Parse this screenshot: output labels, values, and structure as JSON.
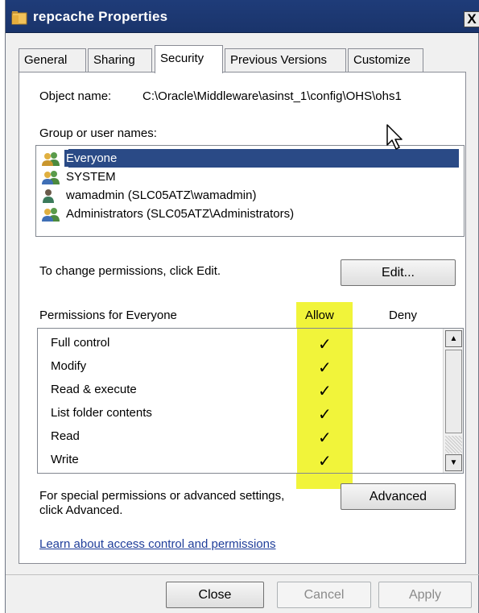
{
  "window": {
    "title": "repcache Properties",
    "close_glyph": "X"
  },
  "tabs": [
    {
      "label": "General",
      "active": false
    },
    {
      "label": "Sharing",
      "active": false
    },
    {
      "label": "Security",
      "active": true
    },
    {
      "label": "Previous Versions",
      "active": false
    },
    {
      "label": "Customize",
      "active": false
    }
  ],
  "security": {
    "object_name_label": "Object name:",
    "object_name_value": "C:\\Oracle\\Middleware\\asinst_1\\config\\OHS\\ohs1",
    "group_label": "Group or user names:",
    "users": [
      {
        "name": "Everyone",
        "icon": "group-icon",
        "selected": true
      },
      {
        "name": "SYSTEM",
        "icon": "group-icon",
        "selected": false
      },
      {
        "name": "wamadmin (SLC05ATZ\\wamadmin)",
        "icon": "user-icon",
        "selected": false
      },
      {
        "name": "Administrators (SLC05ATZ\\Administrators)",
        "icon": "group-icon",
        "selected": false
      }
    ],
    "change_text": "To change permissions, click Edit.",
    "edit_button": "Edit...",
    "permissions_label": "Permissions for Everyone",
    "allow_header": "Allow",
    "deny_header": "Deny",
    "permissions": [
      {
        "name": "Full control",
        "allow": true,
        "deny": false
      },
      {
        "name": "Modify",
        "allow": true,
        "deny": false
      },
      {
        "name": "Read & execute",
        "allow": true,
        "deny": false
      },
      {
        "name": "List folder contents",
        "allow": true,
        "deny": false
      },
      {
        "name": "Read",
        "allow": true,
        "deny": false
      },
      {
        "name": "Write",
        "allow": true,
        "deny": false
      }
    ],
    "check_glyph": "✓",
    "special_text_line1": "For special permissions or advanced settings,",
    "special_text_line2": "click Advanced.",
    "advanced_button": "Advanced",
    "learn_link": "Learn about access control and permissions"
  },
  "footer": {
    "close_button": "Close",
    "cancel_button": "Cancel",
    "apply_button": "Apply"
  },
  "colors": {
    "title_bar": "#1f3c79",
    "selection": "#2a4a86",
    "highlight": "#eef218",
    "link": "#1f3e9a"
  }
}
